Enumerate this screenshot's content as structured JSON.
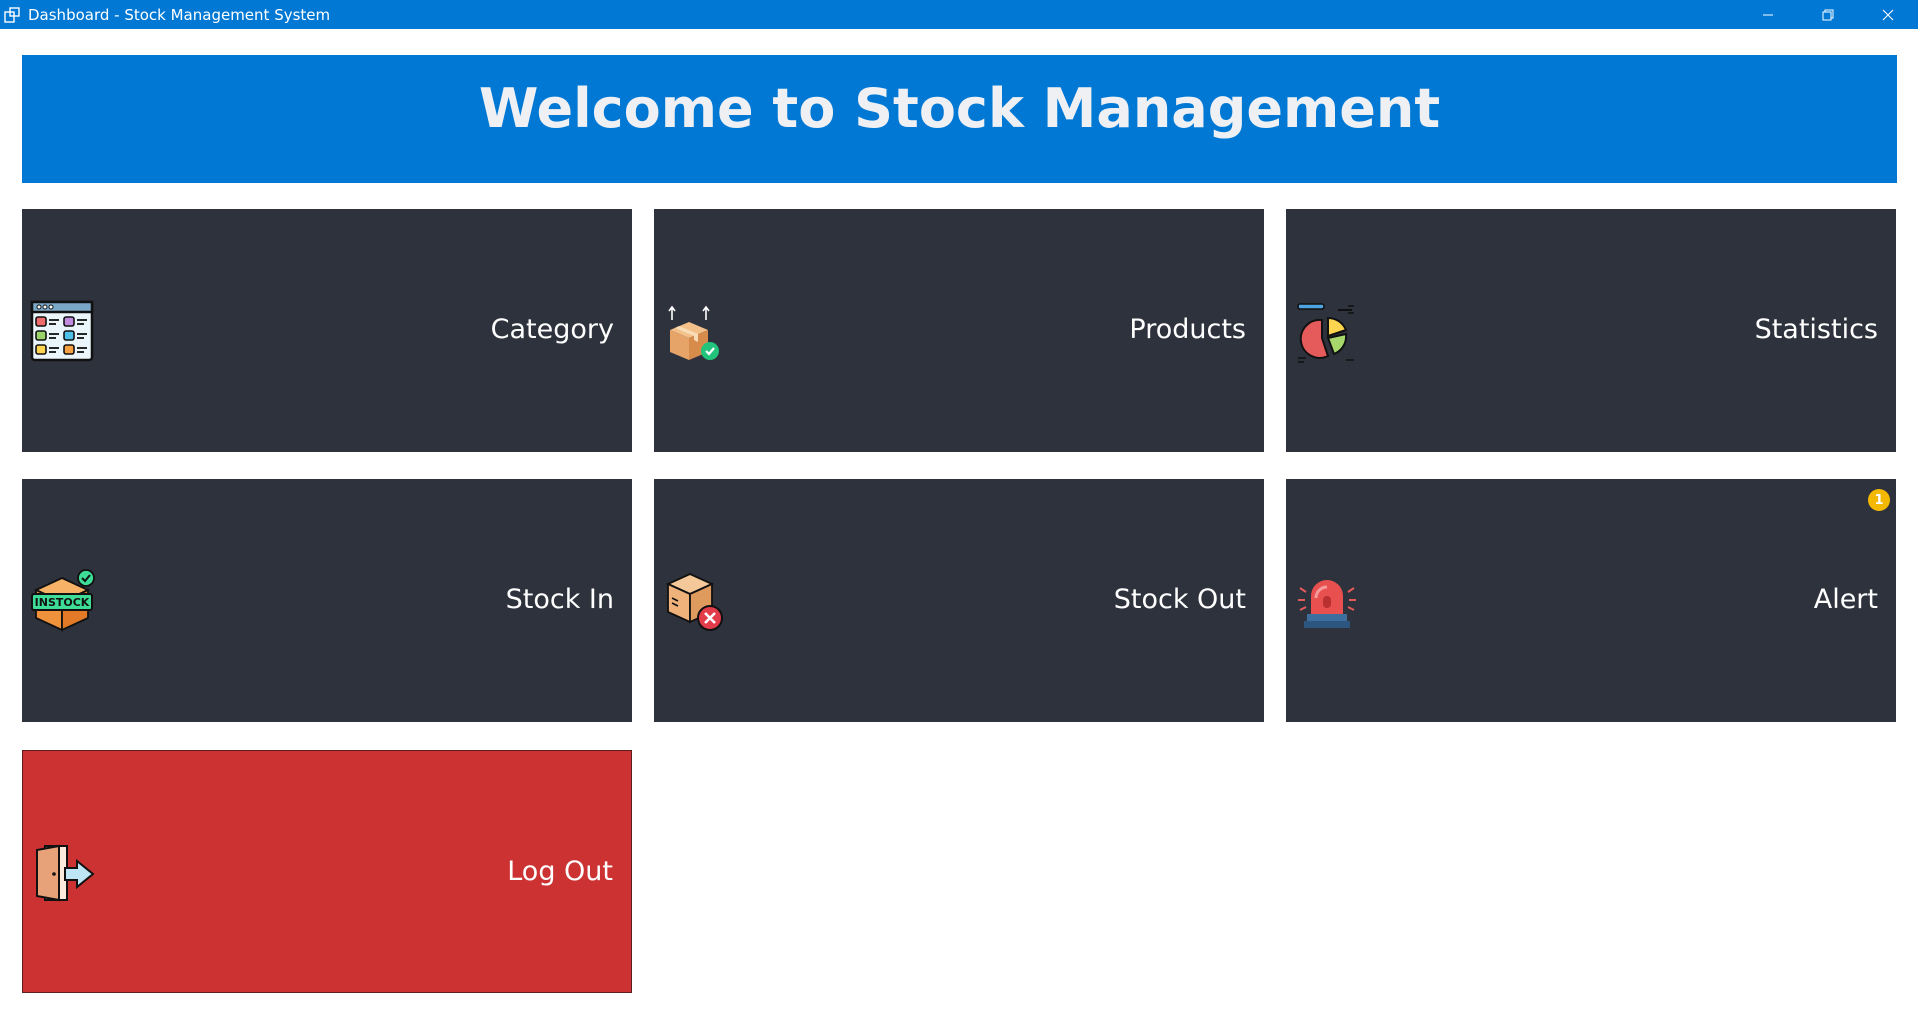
{
  "window": {
    "title": "Dashboard - Stock Management System"
  },
  "banner": {
    "title": "Welcome to Stock Management"
  },
  "tiles": {
    "category": {
      "label": "Category",
      "icon": "category-grid-icon"
    },
    "products": {
      "label": "Products",
      "icon": "product-box-icon"
    },
    "statistics": {
      "label": "Statistics",
      "icon": "pie-chart-icon"
    },
    "stock_in": {
      "label": "Stock In",
      "icon": "in-stock-icon"
    },
    "stock_out": {
      "label": "Stock Out",
      "icon": "out-of-stock-icon"
    },
    "alert": {
      "label": "Alert",
      "icon": "siren-icon",
      "badge": "1"
    },
    "logout": {
      "label": "Log Out",
      "icon": "exit-door-icon"
    }
  },
  "colors": {
    "accent": "#0078d4",
    "tile": "#2e323d",
    "logout": "#cc3232",
    "badge": "#f5b800"
  }
}
